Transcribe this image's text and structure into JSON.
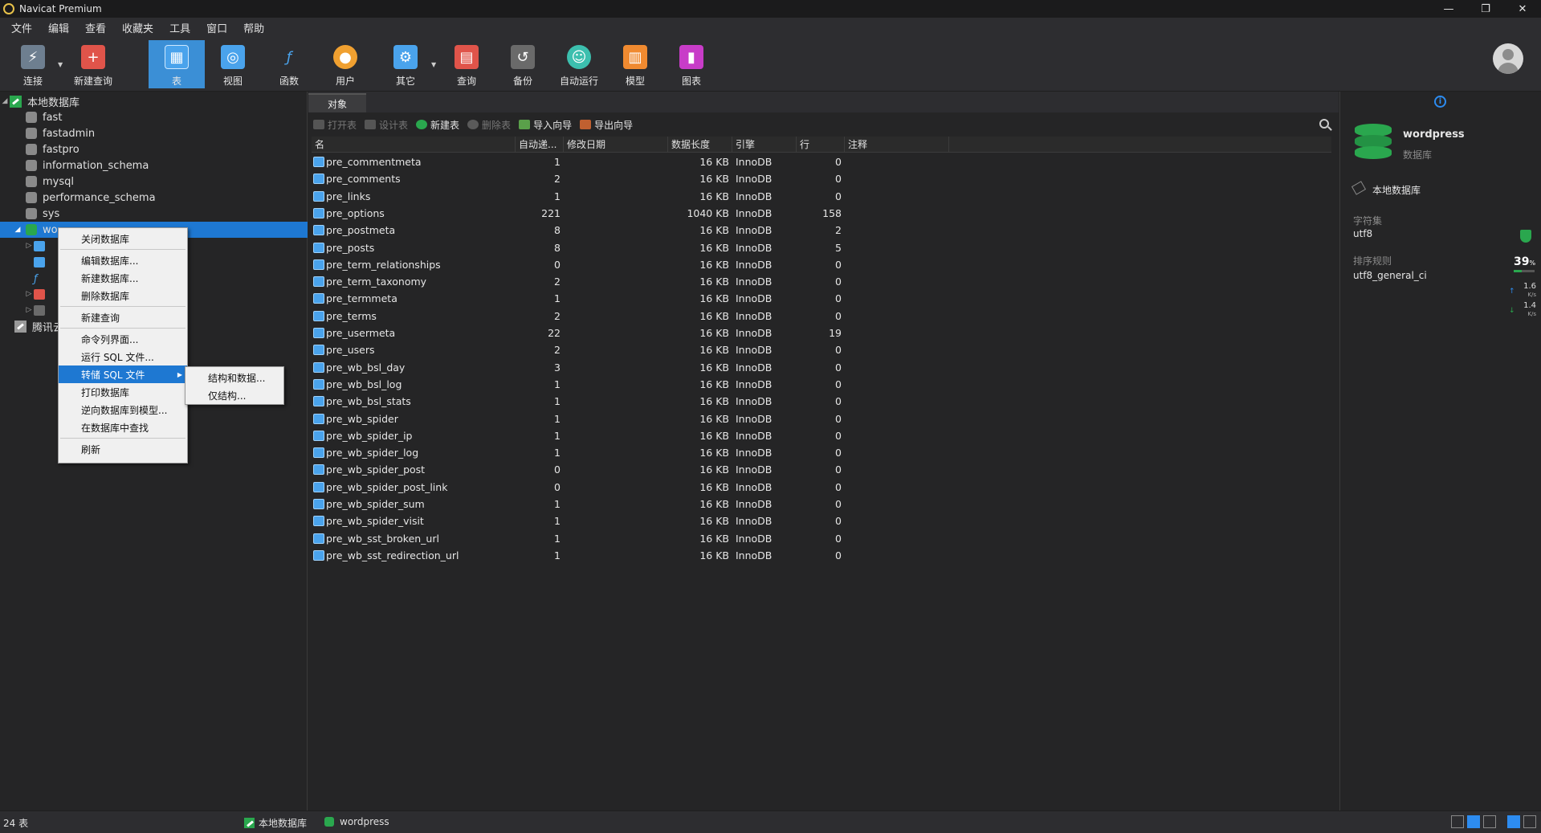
{
  "window": {
    "title": "Navicat Premium",
    "controls": [
      "—",
      "❐",
      "✕"
    ]
  },
  "menu": [
    "文件",
    "编辑",
    "查看",
    "收藏夹",
    "工具",
    "窗口",
    "帮助"
  ],
  "toolbar": [
    {
      "label": "连接",
      "icon": "plug-icon",
      "color": "#8aa0b4"
    },
    {
      "label": "新建查询",
      "icon": "new-query-icon",
      "color": "#e0544a"
    },
    {
      "label": "表",
      "icon": "table-icon",
      "color": "#4aa3ec"
    },
    {
      "label": "视图",
      "icon": "view-icon",
      "color": "#4aa3ec"
    },
    {
      "label": "函数",
      "icon": "function-icon",
      "color": "#4aa3ec"
    },
    {
      "label": "用户",
      "icon": "user-icon",
      "color": "#f0a030"
    },
    {
      "label": "其它",
      "icon": "tools-icon",
      "color": "#4aa3ec"
    },
    {
      "label": "查询",
      "icon": "query-icon",
      "color": "#e0544a"
    },
    {
      "label": "备份",
      "icon": "backup-icon",
      "color": "#8a8a8a"
    },
    {
      "label": "自动运行",
      "icon": "robot-icon",
      "color": "#3cbfae"
    },
    {
      "label": "模型",
      "icon": "model-icon",
      "color": "#f08a30"
    },
    {
      "label": "图表",
      "icon": "chart-icon",
      "color": "#c83cc8"
    }
  ],
  "tree": {
    "connection": "本地数据库",
    "databases": [
      "fast",
      "fastadmin",
      "fastpro",
      "information_schema",
      "mysql",
      "performance_schema",
      "sys"
    ],
    "selected": "wordpress",
    "selected_visible": "wo",
    "second_connection": "腾讯云"
  },
  "context_menu": {
    "items": [
      "关闭数据库",
      "编辑数据库...",
      "新建数据库...",
      "删除数据库",
      "新建查询",
      "命令列界面...",
      "运行 SQL 文件...",
      "转储 SQL 文件",
      "打印数据库",
      "逆向数据库到模型...",
      "在数据库中查找",
      "刷新"
    ],
    "submenu": [
      "结构和数据...",
      "仅结构..."
    ]
  },
  "tab": "对象",
  "object_tools": [
    "打开表",
    "设计表",
    "新建表",
    "删除表",
    "导入向导",
    "导出向导"
  ],
  "columns": [
    "名",
    "自动递...",
    "修改日期",
    "数据长度",
    "引擎",
    "行",
    "注释"
  ],
  "tables": [
    {
      "name": "pre_commentmeta",
      "auto": "1",
      "size": "16 KB",
      "engine": "InnoDB",
      "rows": "0"
    },
    {
      "name": "pre_comments",
      "auto": "2",
      "size": "16 KB",
      "engine": "InnoDB",
      "rows": "0"
    },
    {
      "name": "pre_links",
      "auto": "1",
      "size": "16 KB",
      "engine": "InnoDB",
      "rows": "0"
    },
    {
      "name": "pre_options",
      "auto": "221",
      "size": "1040 KB",
      "engine": "InnoDB",
      "rows": "158"
    },
    {
      "name": "pre_postmeta",
      "auto": "8",
      "size": "16 KB",
      "engine": "InnoDB",
      "rows": "2"
    },
    {
      "name": "pre_posts",
      "auto": "8",
      "size": "16 KB",
      "engine": "InnoDB",
      "rows": "5"
    },
    {
      "name": "pre_term_relationships",
      "auto": "0",
      "size": "16 KB",
      "engine": "InnoDB",
      "rows": "0"
    },
    {
      "name": "pre_term_taxonomy",
      "auto": "2",
      "size": "16 KB",
      "engine": "InnoDB",
      "rows": "0"
    },
    {
      "name": "pre_termmeta",
      "auto": "1",
      "size": "16 KB",
      "engine": "InnoDB",
      "rows": "0"
    },
    {
      "name": "pre_terms",
      "auto": "2",
      "size": "16 KB",
      "engine": "InnoDB",
      "rows": "0"
    },
    {
      "name": "pre_usermeta",
      "auto": "22",
      "size": "16 KB",
      "engine": "InnoDB",
      "rows": "19"
    },
    {
      "name": "pre_users",
      "auto": "2",
      "size": "16 KB",
      "engine": "InnoDB",
      "rows": "0"
    },
    {
      "name": "pre_wb_bsl_day",
      "auto": "3",
      "size": "16 KB",
      "engine": "InnoDB",
      "rows": "0"
    },
    {
      "name": "pre_wb_bsl_log",
      "auto": "1",
      "size": "16 KB",
      "engine": "InnoDB",
      "rows": "0"
    },
    {
      "name": "pre_wb_bsl_stats",
      "auto": "1",
      "size": "16 KB",
      "engine": "InnoDB",
      "rows": "0"
    },
    {
      "name": "pre_wb_spider",
      "auto": "1",
      "size": "16 KB",
      "engine": "InnoDB",
      "rows": "0"
    },
    {
      "name": "pre_wb_spider_ip",
      "auto": "1",
      "size": "16 KB",
      "engine": "InnoDB",
      "rows": "0"
    },
    {
      "name": "pre_wb_spider_log",
      "auto": "1",
      "size": "16 KB",
      "engine": "InnoDB",
      "rows": "0"
    },
    {
      "name": "pre_wb_spider_post",
      "auto": "0",
      "size": "16 KB",
      "engine": "InnoDB",
      "rows": "0"
    },
    {
      "name": "pre_wb_spider_post_link",
      "auto": "0",
      "size": "16 KB",
      "engine": "InnoDB",
      "rows": "0"
    },
    {
      "name": "pre_wb_spider_sum",
      "auto": "1",
      "size": "16 KB",
      "engine": "InnoDB",
      "rows": "0"
    },
    {
      "name": "pre_wb_spider_visit",
      "auto": "1",
      "size": "16 KB",
      "engine": "InnoDB",
      "rows": "0"
    },
    {
      "name": "pre_wb_sst_broken_url",
      "auto": "1",
      "size": "16 KB",
      "engine": "InnoDB",
      "rows": "0"
    },
    {
      "name": "pre_wb_sst_redirection_url",
      "auto": "1",
      "size": "16 KB",
      "engine": "InnoDB",
      "rows": "0"
    }
  ],
  "info": {
    "db_name": "wordpress",
    "db_type": "数据库",
    "connection": "本地数据库",
    "charset_label": "字符集",
    "charset": "utf8",
    "collation_label": "排序规则",
    "collation": "utf8_general_ci",
    "usage_pct": "39",
    "usage_unit": "%",
    "up_speed": "1.6",
    "down_speed": "1.4",
    "speed_unit": "K/s"
  },
  "status": {
    "count": "24 表",
    "connection": "本地数据库",
    "database": "wordpress"
  },
  "accent": "#1e78d2"
}
